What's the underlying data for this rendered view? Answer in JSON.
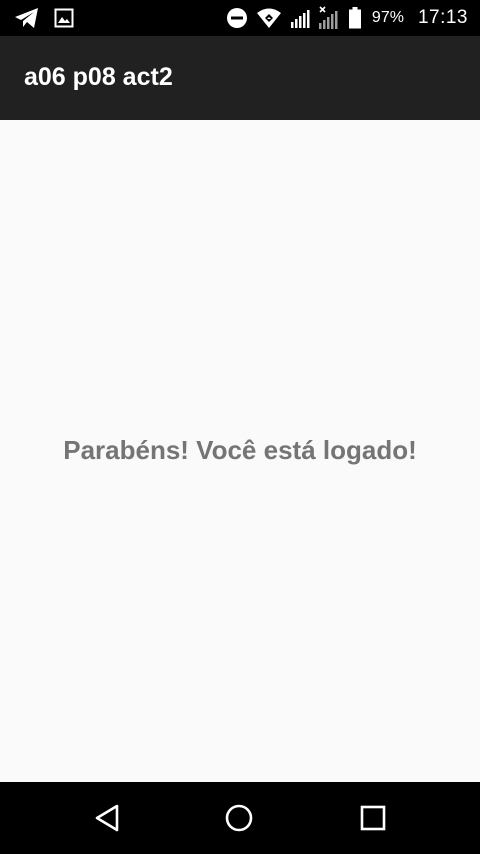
{
  "status_bar": {
    "left_icons": [
      "telegram-icon",
      "image-icon"
    ],
    "right_icons": [
      "do-not-disturb-icon",
      "wifi-icon",
      "cellular-signal-icon",
      "cellular-signal-no-data-icon",
      "battery-icon"
    ],
    "battery_percent": "97%",
    "time": "17:13"
  },
  "app_bar": {
    "title": "a06 p08 act2",
    "background": "#212121"
  },
  "content": {
    "message": "Parabéns! Você está logado!",
    "message_color": "#757575",
    "background": "#fafafa"
  },
  "nav_bar": {
    "buttons": [
      "back-icon",
      "home-icon",
      "recent-apps-icon"
    ]
  }
}
